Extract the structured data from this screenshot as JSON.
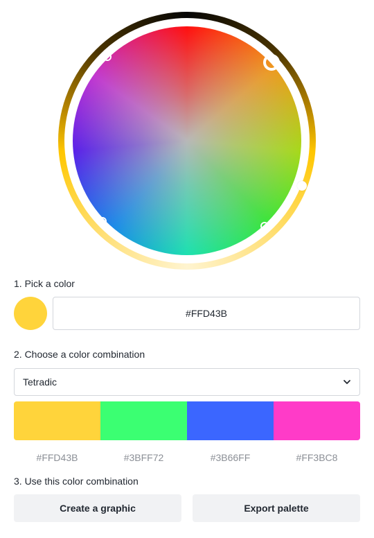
{
  "steps": {
    "pick": "1. Pick a color",
    "combination": "2. Choose a color combination",
    "use": "3. Use this color combination"
  },
  "picker": {
    "selected_hex": "#FFD43B",
    "selected_color": "#FFD43B"
  },
  "combination_select": {
    "value": "Tetradic",
    "icon": "chevron-down-icon"
  },
  "palette": [
    {
      "hex": "#FFD43B",
      "color": "#FFD43B"
    },
    {
      "hex": "#3BFF72",
      "color": "#3BFF72"
    },
    {
      "hex": "#3B66FF",
      "color": "#3B66FF"
    },
    {
      "hex": "#FF3BC8",
      "color": "#FF3BC8"
    }
  ],
  "actions": {
    "create": "Create a graphic",
    "export": "Export palette"
  }
}
